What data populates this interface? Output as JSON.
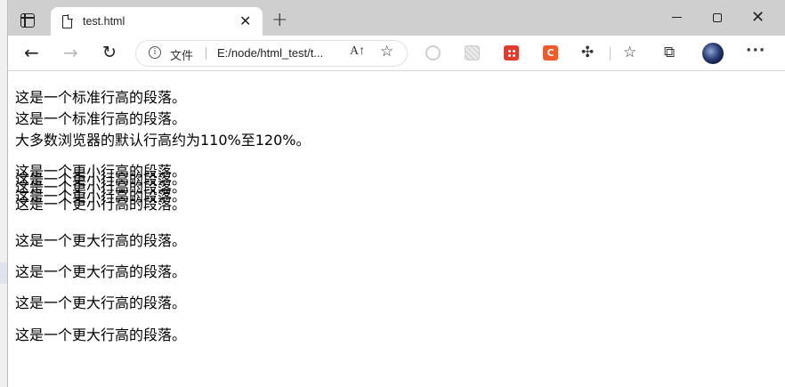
{
  "browser": {
    "tab_title": "test.html",
    "address": {
      "info_glyph": "i",
      "security_label": "文件",
      "url": "E:/node/html_test/t...",
      "read_aloud_glyph": "A↑"
    },
    "icons": {
      "tab_actions": "tab-actions-icon",
      "page": "page-icon",
      "close": "close-icon",
      "new_tab": "plus-icon",
      "back": "arrow-left-icon",
      "forward": "arrow-right-icon",
      "refresh": "refresh-icon",
      "favorites_add": "star-plus-icon",
      "extensions": "puzzle-icon",
      "favorites": "star-list-icon",
      "collections": "collections-icon",
      "more": "ellipsis-icon"
    },
    "extension_badges": [
      "",
      "",
      "",
      "C"
    ]
  },
  "content": {
    "paragraphs": [
      "这是一个标准行高的段落。",
      "这是一个标准行高的段落。",
      "大多数浏览器的默认行高约为110%至120%。",
      "这是一个更小行高的段落。",
      "这是一个更小行高的段落。",
      "这是一个更小行高的段落。",
      "这是一个更小行高的段落。",
      "这是一个更小行高的段落。",
      "这是一个更大行高的段落。",
      "这是一个更大行高的段落。",
      "这是一个更大行高的段落。",
      "这是一个更大行高的段落。"
    ]
  }
}
